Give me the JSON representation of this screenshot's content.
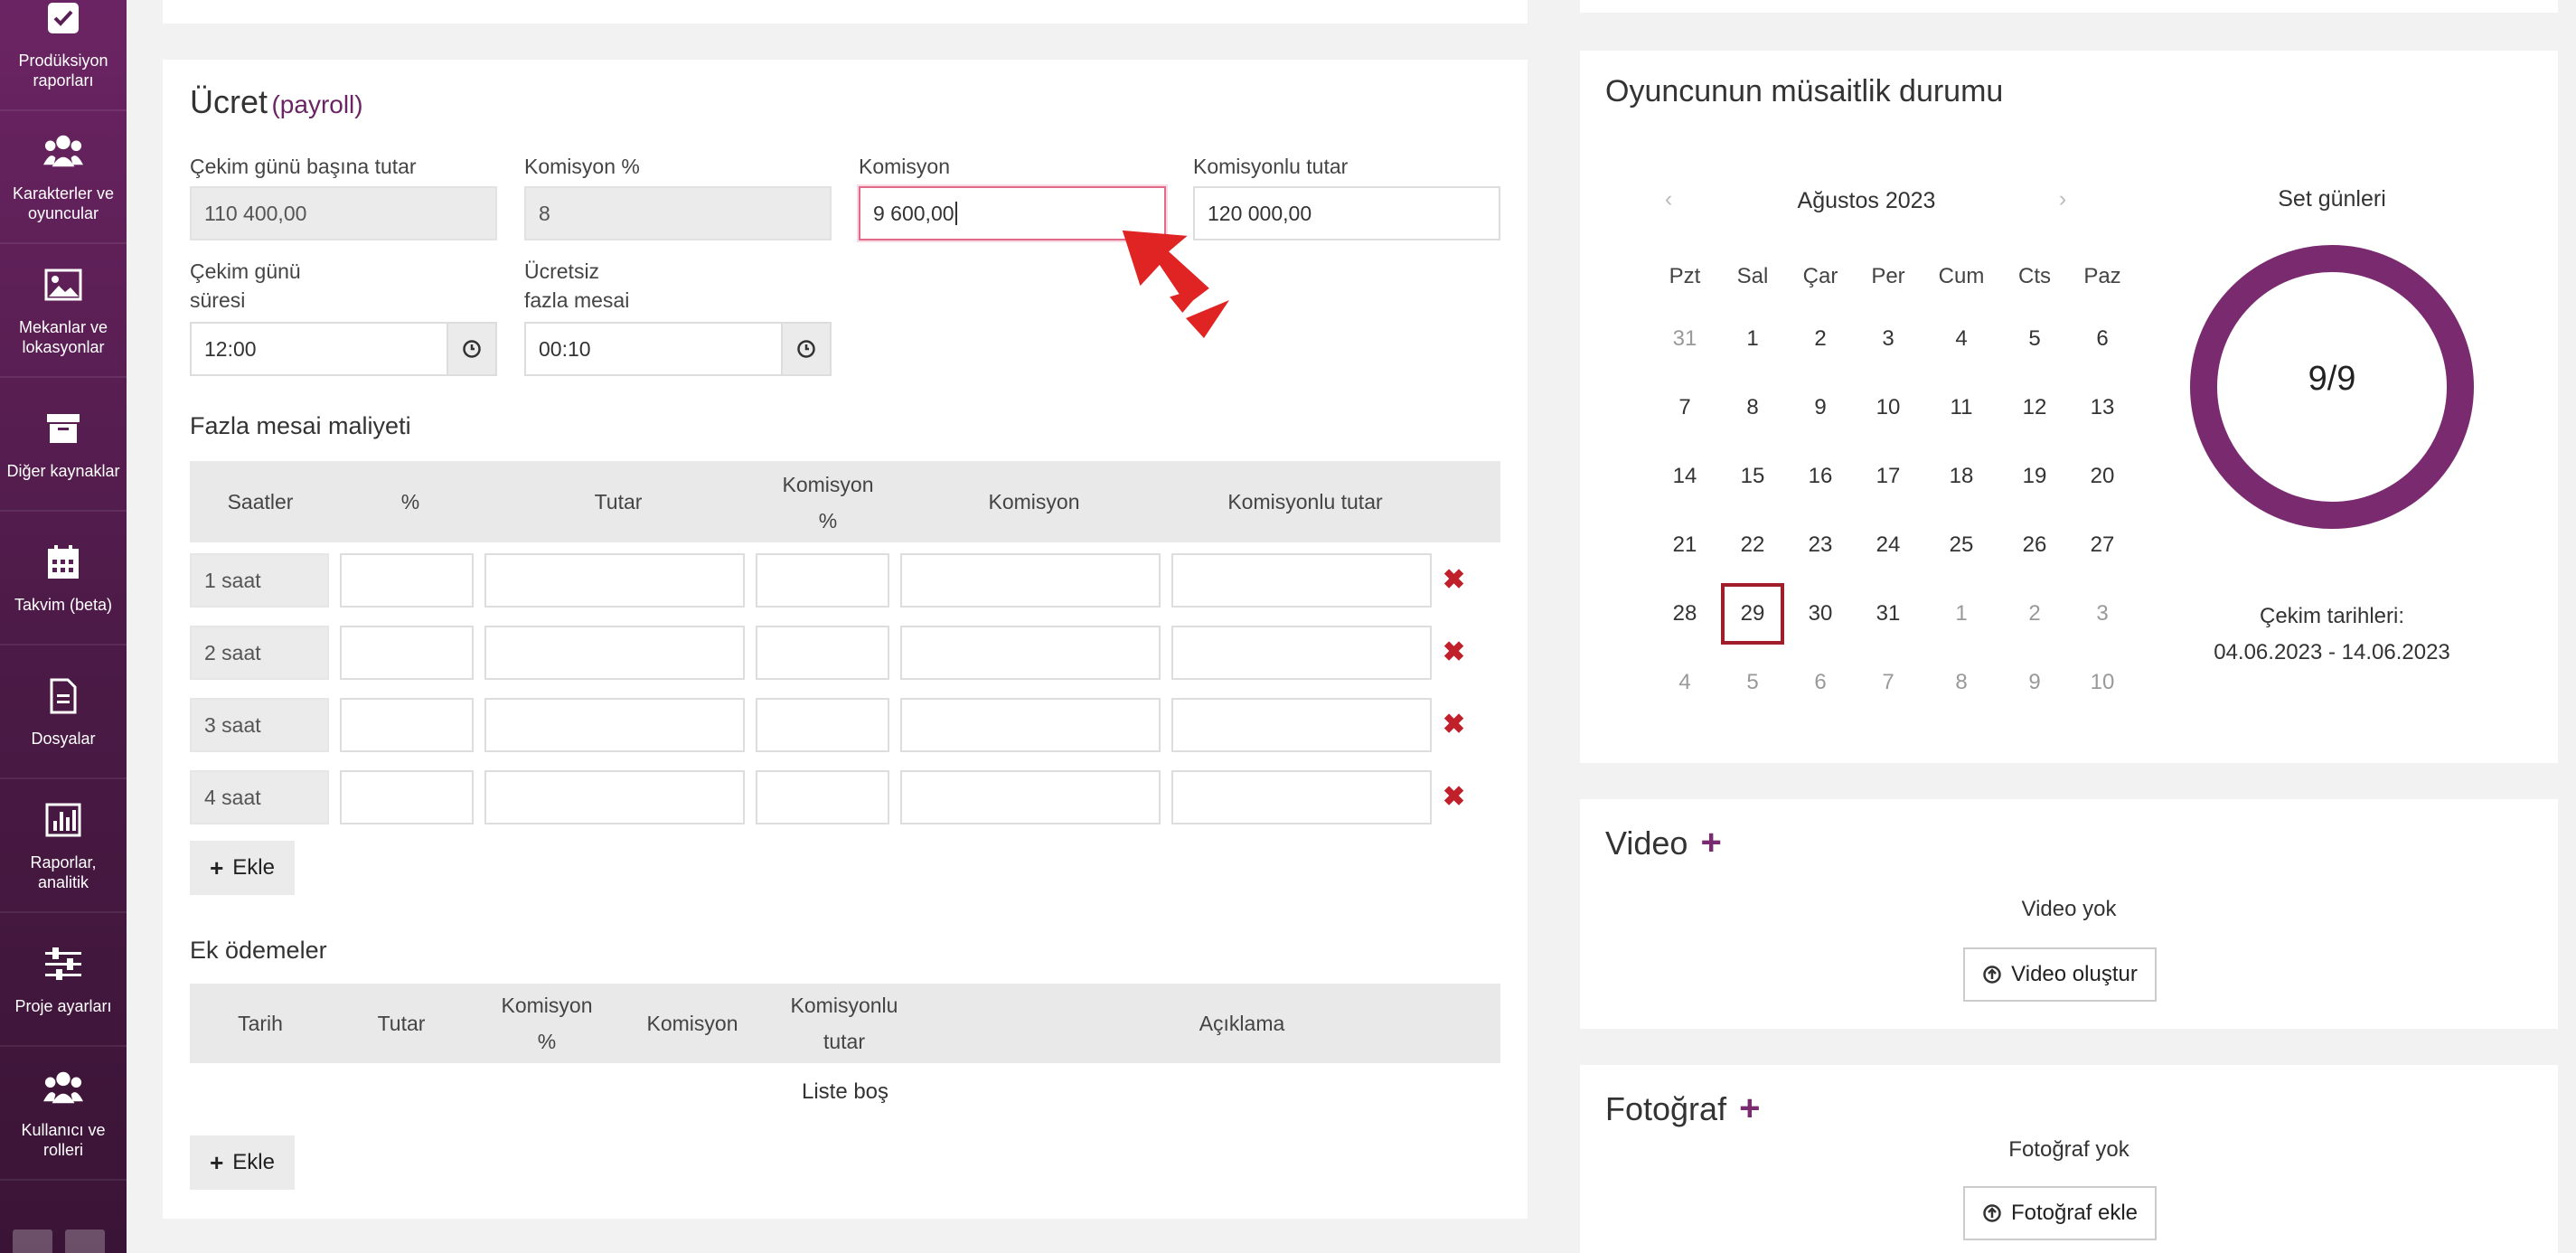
{
  "sidebar": {
    "items": [
      {
        "label": "Prodüksiyon raporları",
        "icon": "checkbox-icon"
      },
      {
        "label": "Karakterler ve oyuncular",
        "icon": "users-icon"
      },
      {
        "label": "Mekanlar ve lokasyonlar",
        "icon": "image-icon"
      },
      {
        "label": "Diğer kaynaklar",
        "icon": "archive-icon"
      },
      {
        "label": "Takvim (beta)",
        "icon": "calendar-icon"
      },
      {
        "label": "Dosyalar",
        "icon": "file-icon"
      },
      {
        "label": "Raporlar, analitik",
        "icon": "bar-chart-icon"
      },
      {
        "label": "Proje ayarları",
        "icon": "sliders-icon"
      },
      {
        "label": "Kullanıcı ve rolleri",
        "icon": "users-icon"
      }
    ]
  },
  "payroll": {
    "title": "Ücret",
    "subtitle": "(payroll)",
    "fields": {
      "per_day_label": "Çekim günü başına tutar",
      "per_day_value": "110 400,00",
      "commission_pct_label": "Komisyon %",
      "commission_pct_value": "8",
      "commission_label": "Komisyon",
      "commission_value": "9 600,00",
      "total_label": "Komisyonlu tutar",
      "total_value": "120 000,00",
      "duration_label_1": "Çekim günü",
      "duration_label_2": "süresi",
      "duration_value": "12:00",
      "free_overtime_label_1": "Ücretsiz",
      "free_overtime_label_2": "fazla mesai",
      "free_overtime_value": "00:10"
    },
    "overtime": {
      "title": "Fazla mesai maliyeti",
      "headers": {
        "hours": "Saatler",
        "pct": "%",
        "amount": "Tutar",
        "comm_pct_1": "Komisyon",
        "comm_pct_2": "%",
        "comm": "Komisyon",
        "total": "Komisyonlu tutar"
      },
      "rows": [
        "1 saat",
        "2 saat",
        "3 saat",
        "4 saat"
      ],
      "add_label": "Ekle"
    },
    "extra": {
      "title": "Ek ödemeler",
      "headers": {
        "date": "Tarih",
        "amount": "Tutar",
        "comm_pct_1": "Komisyon",
        "comm_pct_2": "%",
        "comm": "Komisyon",
        "total_1": "Komisyonlu",
        "total_2": "tutar",
        "desc": "Açıklama"
      },
      "empty": "Liste boş",
      "add_label": "Ekle"
    }
  },
  "availability": {
    "title": "Oyuncunun müsaitlik durumu",
    "month": "Ağustos 2023",
    "prev": "‹",
    "next": "›",
    "day_names": [
      "Pzt",
      "Sal",
      "Çar",
      "Per",
      "Cum",
      "Cts",
      "Paz"
    ],
    "weeks": [
      [
        "31",
        "1",
        "2",
        "3",
        "4",
        "5",
        "6"
      ],
      [
        "7",
        "8",
        "9",
        "10",
        "11",
        "12",
        "13"
      ],
      [
        "14",
        "15",
        "16",
        "17",
        "18",
        "19",
        "20"
      ],
      [
        "21",
        "22",
        "23",
        "24",
        "25",
        "26",
        "27"
      ],
      [
        "28",
        "29",
        "30",
        "31",
        "1",
        "2",
        "3"
      ],
      [
        "4",
        "5",
        "6",
        "7",
        "8",
        "9",
        "10"
      ]
    ],
    "set_days_label": "Set günleri",
    "set_days_value": "9/9",
    "shoot_dates_label": "Çekim tarihleri:",
    "shoot_dates_value": "04.06.2023 - 14.06.2023"
  },
  "video": {
    "title": "Video",
    "empty": "Video yok",
    "button": "Video oluştur"
  },
  "photo": {
    "title": "Fotoğraf",
    "empty": "Fotoğraf yok",
    "button": "Fotoğraf ekle"
  },
  "colors": {
    "brand": "#6b2463",
    "danger": "#c0202a",
    "today": "#a01e2a",
    "ring": "#7a2a6e"
  }
}
